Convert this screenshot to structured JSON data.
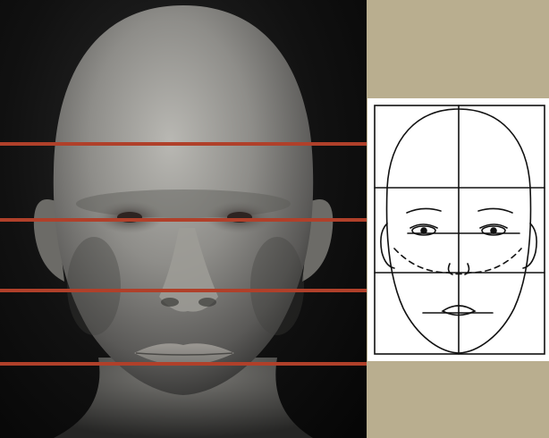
{
  "colors": {
    "guide_line": "#b0402a",
    "side_background": "#b9ae8f",
    "sketch_stroke": "#111111",
    "render_skin": "#8a8a88"
  },
  "render_panel": {
    "guide_line_count": 4
  },
  "sketch": {
    "grid_rows": 3,
    "grid_cols": 2
  }
}
